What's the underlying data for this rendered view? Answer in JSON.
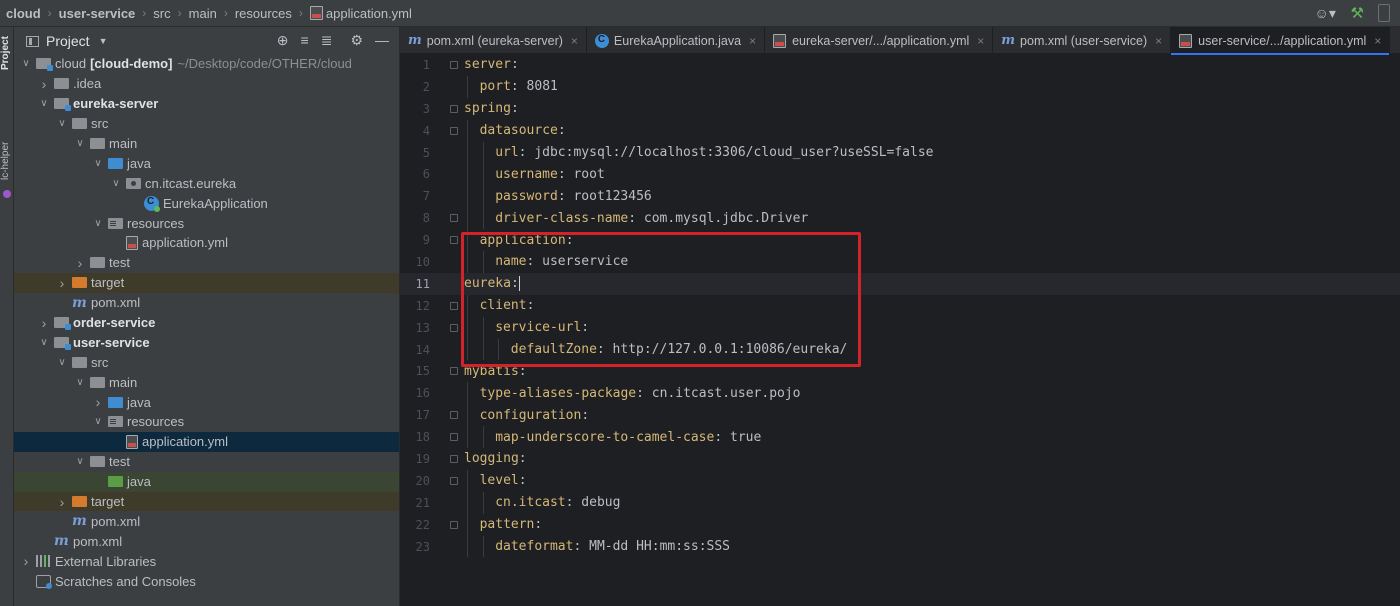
{
  "breadcrumb": [
    "cloud",
    "user-service",
    "src",
    "main",
    "resources",
    "application.yml"
  ],
  "side_strip": {
    "project_label": "Project",
    "helper_label": "lc-helper"
  },
  "panel": {
    "title": "Project"
  },
  "tree": [
    {
      "depth": 0,
      "arrow": "down",
      "icon": "mod",
      "label": "cloud",
      "bold_label": "[cloud-demo]",
      "path": "~/Desktop/code/OTHER/cloud"
    },
    {
      "depth": 1,
      "arrow": "right",
      "icon": "grey",
      "label": ".idea"
    },
    {
      "depth": 1,
      "arrow": "down",
      "icon": "mod",
      "label": "eureka-server",
      "bold": true
    },
    {
      "depth": 2,
      "arrow": "down",
      "icon": "grey",
      "label": "src"
    },
    {
      "depth": 3,
      "arrow": "down",
      "icon": "grey",
      "label": "main"
    },
    {
      "depth": 4,
      "arrow": "down",
      "icon": "blue",
      "label": "java"
    },
    {
      "depth": 5,
      "arrow": "down",
      "icon": "pkg",
      "label": "cn.itcast.eureka"
    },
    {
      "depth": 6,
      "arrow": "none",
      "icon": "class",
      "label": "EurekaApplication"
    },
    {
      "depth": 4,
      "arrow": "down",
      "icon": "res",
      "label": "resources"
    },
    {
      "depth": 5,
      "arrow": "none",
      "icon": "yml",
      "label": "application.yml"
    },
    {
      "depth": 3,
      "arrow": "right",
      "icon": "grey",
      "label": "test"
    },
    {
      "depth": 2,
      "arrow": "right",
      "icon": "orange",
      "label": "target",
      "hl": "orange"
    },
    {
      "depth": 2,
      "arrow": "none",
      "icon": "maven",
      "label": "pom.xml"
    },
    {
      "depth": 1,
      "arrow": "right",
      "icon": "mod",
      "label": "order-service",
      "bold": true
    },
    {
      "depth": 1,
      "arrow": "down",
      "icon": "mod",
      "label": "user-service",
      "bold": true
    },
    {
      "depth": 2,
      "arrow": "down",
      "icon": "grey",
      "label": "src"
    },
    {
      "depth": 3,
      "arrow": "down",
      "icon": "grey",
      "label": "main"
    },
    {
      "depth": 4,
      "arrow": "right",
      "icon": "blue",
      "label": "java"
    },
    {
      "depth": 4,
      "arrow": "down",
      "icon": "res",
      "label": "resources"
    },
    {
      "depth": 5,
      "arrow": "none",
      "icon": "yml",
      "label": "application.yml",
      "selected": true
    },
    {
      "depth": 3,
      "arrow": "down",
      "icon": "grey",
      "label": "test"
    },
    {
      "depth": 4,
      "arrow": "none",
      "icon": "green",
      "label": "java",
      "hl": "green"
    },
    {
      "depth": 2,
      "arrow": "right",
      "icon": "orange",
      "label": "target",
      "hl": "orange"
    },
    {
      "depth": 2,
      "arrow": "none",
      "icon": "maven",
      "label": "pom.xml"
    },
    {
      "depth": 1,
      "arrow": "none",
      "icon": "maven",
      "label": "pom.xml"
    },
    {
      "depth": 0,
      "arrow": "right",
      "icon": "lib",
      "label": "External Libraries"
    },
    {
      "depth": 0,
      "arrow": "none",
      "icon": "scratch",
      "label": "Scratches and Consoles"
    }
  ],
  "tabs": [
    {
      "icon": "maven",
      "label": "pom.xml (eureka-server)"
    },
    {
      "icon": "class",
      "label": "EurekaApplication.java"
    },
    {
      "icon": "yml",
      "label": "eureka-server/.../application.yml"
    },
    {
      "icon": "maven",
      "label": "pom.xml (user-service)"
    },
    {
      "icon": "yml",
      "label": "user-service/.../application.yml",
      "active": true
    }
  ],
  "code": [
    {
      "n": "1",
      "indent": 0,
      "key": "server",
      "val": "",
      "fold": true
    },
    {
      "n": "2",
      "indent": 1,
      "key": "port",
      "val": " 8081"
    },
    {
      "n": "3",
      "indent": 0,
      "key": "spring",
      "val": "",
      "fold": true
    },
    {
      "n": "4",
      "indent": 1,
      "key": "datasource",
      "val": "",
      "fold": true
    },
    {
      "n": "5",
      "indent": 2,
      "key": "url",
      "val": " jdbc:mysql://localhost:3306/cloud_user?useSSL=false"
    },
    {
      "n": "6",
      "indent": 2,
      "key": "username",
      "val": " root"
    },
    {
      "n": "7",
      "indent": 2,
      "key": "password",
      "val": " root123456"
    },
    {
      "n": "8",
      "indent": 2,
      "key": "driver-class-name",
      "val": " com.mysql.jdbc.Driver",
      "fold": true
    },
    {
      "n": "9",
      "indent": 1,
      "key": "application",
      "val": "",
      "fold": true
    },
    {
      "n": "10",
      "indent": 2,
      "key": "name",
      "val": " userservice"
    },
    {
      "n": "11",
      "indent": 0,
      "key": "eureka",
      "val": "",
      "current": true
    },
    {
      "n": "12",
      "indent": 1,
      "key": "client",
      "val": "",
      "fold": true
    },
    {
      "n": "13",
      "indent": 2,
      "key": "service-url",
      "val": "",
      "fold": true
    },
    {
      "n": "14",
      "indent": 3,
      "key": "defaultZone",
      "val": " http://127.0.0.1:10086/eureka/"
    },
    {
      "n": "15",
      "indent": 0,
      "key": "mybatis",
      "val": "",
      "fold": true
    },
    {
      "n": "16",
      "indent": 1,
      "key": "type-aliases-package",
      "val": " cn.itcast.user.pojo"
    },
    {
      "n": "17",
      "indent": 1,
      "key": "configuration",
      "val": "",
      "fold": true
    },
    {
      "n": "18",
      "indent": 2,
      "key": "map-underscore-to-camel-case",
      "val": " true",
      "fold": true
    },
    {
      "n": "19",
      "indent": 0,
      "key": "logging",
      "val": "",
      "fold": true
    },
    {
      "n": "20",
      "indent": 1,
      "key": "level",
      "val": "",
      "fold": true
    },
    {
      "n": "21",
      "indent": 2,
      "key": "cn.itcast",
      "val": " debug"
    },
    {
      "n": "22",
      "indent": 1,
      "key": "pattern",
      "val": "",
      "fold": true
    },
    {
      "n": "23",
      "indent": 2,
      "key": "dateformat",
      "val": " MM-dd HH:mm:ss:SSS"
    }
  ],
  "colors": {
    "key": "#d5b778",
    "value": "#bcbec4",
    "highlight_box": "#d3222a",
    "selection": "#0d293e"
  }
}
